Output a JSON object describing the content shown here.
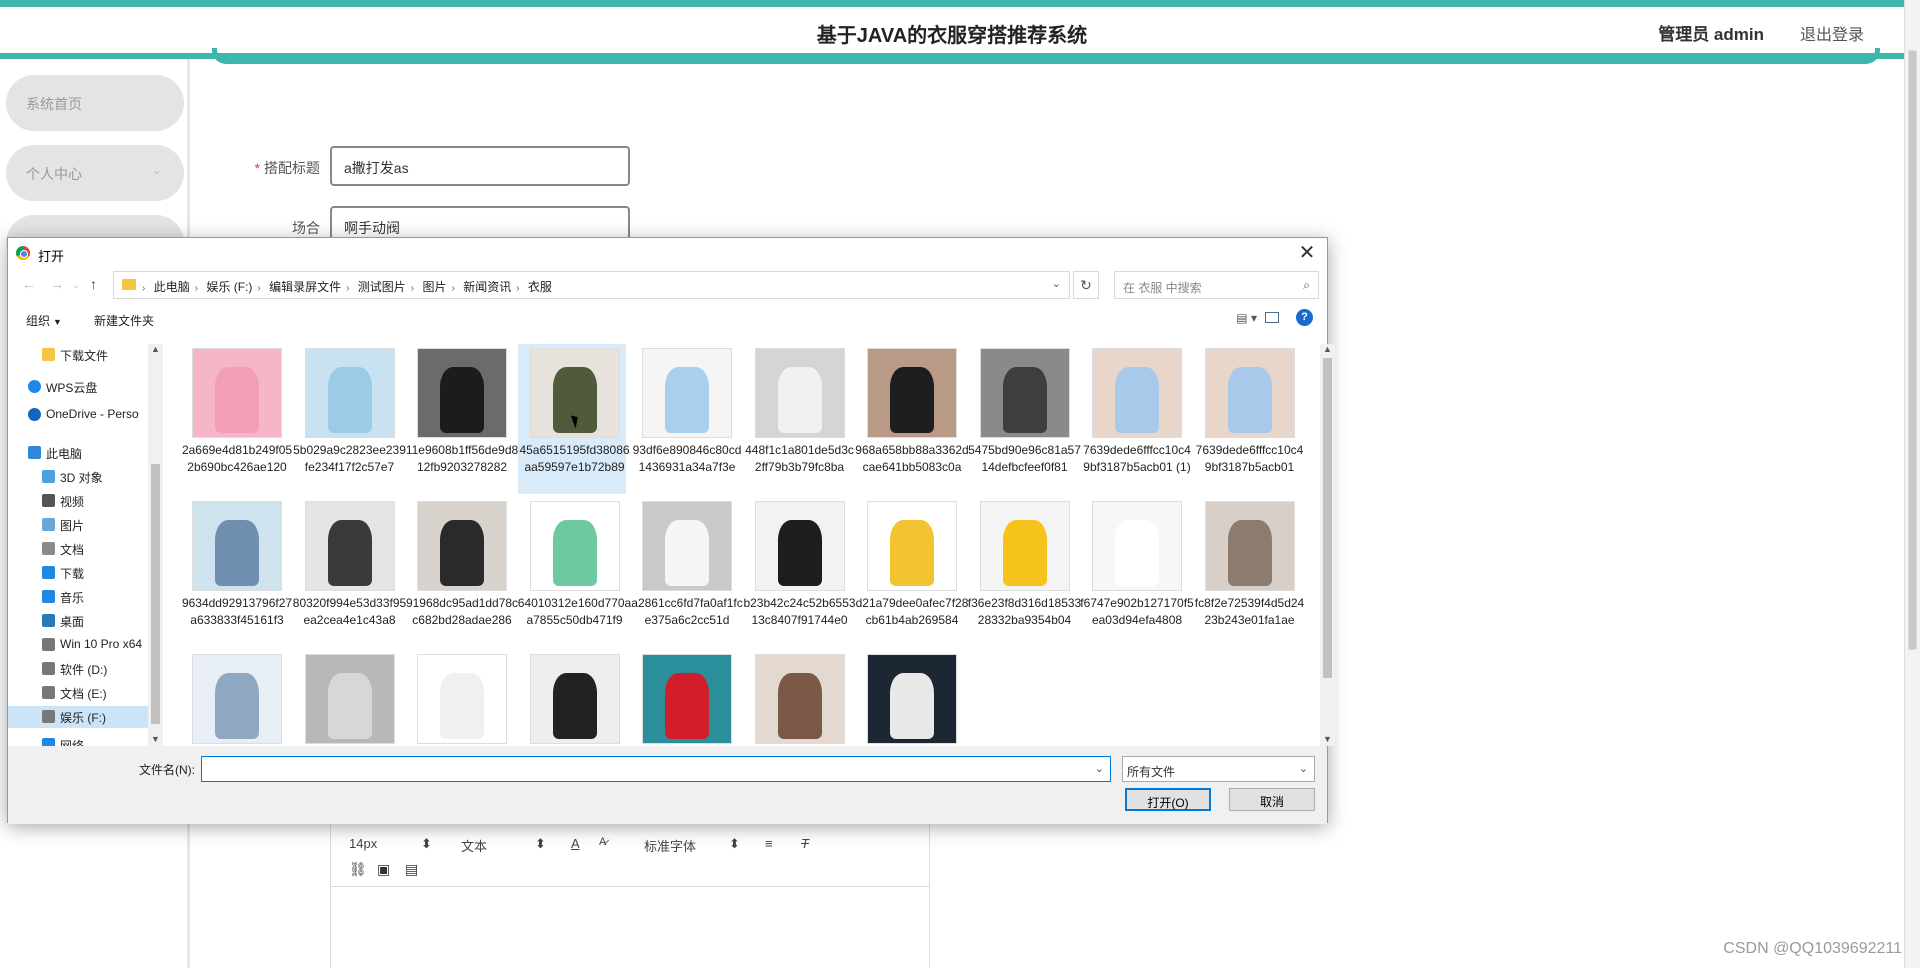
{
  "header": {
    "title": "基于JAVA的衣服穿搭推荐系统",
    "user": "管理员 admin",
    "logout": "退出登录"
  },
  "sidebar": {
    "items": [
      {
        "label": "系统首页"
      },
      {
        "label": "个人中心"
      },
      {
        "label": ""
      }
    ]
  },
  "form": {
    "fields": [
      {
        "label": "搭配标题",
        "required": true,
        "value": "a撒打发as"
      },
      {
        "label": "场合",
        "required": false,
        "value": "啊手动阀"
      }
    ]
  },
  "editor": {
    "font_size": "14px",
    "block_type": "文本",
    "font_family": "标准字体"
  },
  "watermark": "CSDN @QQ1039692211",
  "dialog": {
    "title": "打开",
    "breadcrumbs": [
      "此电脑",
      "娱乐 (F:)",
      "编辑录屏文件",
      "测试图片",
      "图片",
      "新闻资讯",
      "衣服"
    ],
    "search_placeholder": "在 衣服 中搜索",
    "commands": {
      "organize": "组织",
      "new_folder": "新建文件夹"
    },
    "tree": [
      {
        "label": "下载文件",
        "icon": "folder-icon"
      },
      {
        "label": "WPS云盘",
        "icon": "cloud-icon"
      },
      {
        "label": "OneDrive - Perso",
        "icon": "onedrive-icon"
      },
      {
        "label": "此电脑",
        "icon": "computer-icon"
      },
      {
        "label": "3D 对象",
        "icon": "3d-objects-icon"
      },
      {
        "label": "视频",
        "icon": "video-icon"
      },
      {
        "label": "图片",
        "icon": "pictures-icon"
      },
      {
        "label": "文档",
        "icon": "documents-icon"
      },
      {
        "label": "下载",
        "icon": "download-icon"
      },
      {
        "label": "音乐",
        "icon": "music-icon"
      },
      {
        "label": "桌面",
        "icon": "desktop-icon"
      },
      {
        "label": "Win 10 Pro x64",
        "icon": "drive-icon"
      },
      {
        "label": "软件 (D:)",
        "icon": "drive-icon"
      },
      {
        "label": "文档 (E:)",
        "icon": "drive-icon"
      },
      {
        "label": "娱乐 (F:)",
        "icon": "drive-icon",
        "selected": true
      },
      {
        "label": "网络",
        "icon": "network-icon"
      }
    ],
    "files": [
      {
        "name": "2a669e4d81b249f052b690bc426ae120",
        "color": "#f7b6c8",
        "accent": "#f29fb6"
      },
      {
        "name": "5b029a9c2823ee239fe234f17f2c57e7",
        "color": "#c9e2f2",
        "accent": "#9ccbe6"
      },
      {
        "name": "11e9608b1ff56de9d812fb9203278282",
        "color": "#6b6b6b",
        "accent": "#1c1c1c"
      },
      {
        "name": "45a6515195fd38086aa59597e1b72b89",
        "color": "#e7e3dc",
        "accent": "#4f5b3a",
        "selected": true
      },
      {
        "name": "93df6e890846c80cd1436931a34a7f3e",
        "color": "#f5f5f5",
        "accent": "#a9cfee"
      },
      {
        "name": "448f1c1a801de5d3c2ff79b3b79fc8ba",
        "color": "#d5d5d5",
        "accent": "#f1f1f1"
      },
      {
        "name": "968a658bb88a3362dcae641bb5083c0a",
        "color": "#b89a86",
        "accent": "#1e1e1e"
      },
      {
        "name": "5475bd90e96c81a5714defbcfeef0f81",
        "color": "#8a8a8a",
        "accent": "#3e3e3e"
      },
      {
        "name": "7639dede6fffcc10c49bf3187b5acb01 (1)",
        "color": "#e8d6cb",
        "accent": "#a8c9ea"
      },
      {
        "name": "7639dede6fffcc10c49bf3187b5acb01",
        "color": "#e8d6cb",
        "accent": "#a8c9ea"
      },
      {
        "name": "9634dd92913796f27a633833f45161f3",
        "color": "#cfe3ee",
        "accent": "#6e8fb0"
      },
      {
        "name": "80320f994e53d33f95ea2cea4e1c43a8",
        "color": "#e4e4e4",
        "accent": "#3a3a3a"
      },
      {
        "name": "91968dc95ad1dd78cc682bd28adae286",
        "color": "#d9d3cd",
        "accent": "#2a2a2a"
      },
      {
        "name": "64010312e160d770aa7855c50db471f9",
        "color": "#ffffff",
        "accent": "#6cc9a0"
      },
      {
        "name": "a2861cc6fd7fa0af1fce375a6c2cc51d",
        "color": "#c9c9c9",
        "accent": "#f5f5f5"
      },
      {
        "name": "b23b42c24c52b655313c8407f91744e0",
        "color": "#f2f2f2",
        "accent": "#1d1d1d"
      },
      {
        "name": "d21a79dee0afec7f28cb61b4ab269584",
        "color": "#ffffff",
        "accent": "#f2c230"
      },
      {
        "name": "f36e23f8d316d1853328332ba9354b04",
        "color": "#f4f4f4",
        "accent": "#f6c21c"
      },
      {
        "name": "f6747e902b127170f5ea03d94efa4808",
        "color": "#f7f7f7",
        "accent": "#ffffff"
      },
      {
        "name": "fc8f2e72539f4d5d2423b243e01fa1ae",
        "color": "#d8d0c8",
        "accent": "#8c7b6f"
      },
      {
        "name": "",
        "color": "#e7eef5",
        "accent": "#8fa8c2"
      },
      {
        "name": "",
        "color": "#b8b8b8",
        "accent": "#d7d7d7"
      },
      {
        "name": "",
        "color": "#ffffff",
        "accent": "#f0f0f0"
      },
      {
        "name": "",
        "color": "#eeeeee",
        "accent": "#222222"
      },
      {
        "name": "",
        "color": "#2a8f9a",
        "accent": "#d21d2a"
      },
      {
        "name": "",
        "color": "#e4d9d0",
        "accent": "#7a5a47"
      },
      {
        "name": "",
        "color": "#1d2633",
        "accent": "#e8e8e8"
      }
    ],
    "filename_label": "文件名(N):",
    "filename_value": "",
    "filetype": "所有文件",
    "open_button": "打开(O)",
    "cancel_button": "取消"
  }
}
